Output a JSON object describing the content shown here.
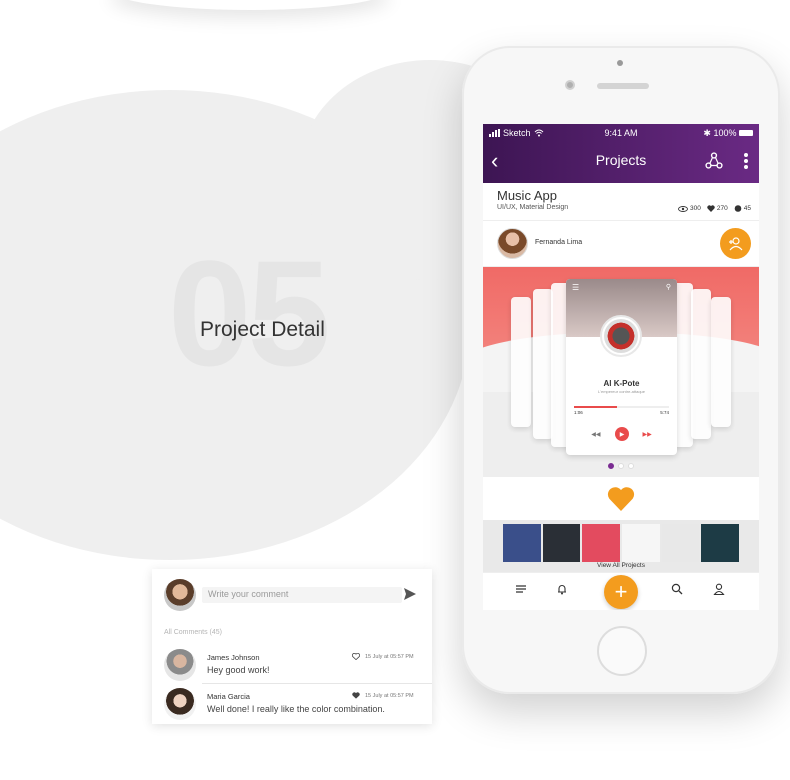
{
  "section": {
    "number": "05",
    "title": "Project Detail"
  },
  "status_bar": {
    "carrier": "Sketch",
    "time": "9:41 AM",
    "battery": "100%"
  },
  "app_bar": {
    "title": "Projects"
  },
  "project": {
    "name": "Music App",
    "tags": "UI/UX, Material Design",
    "views": "300",
    "likes": "270",
    "comments": "45"
  },
  "author": {
    "name": "Fernanda Lima"
  },
  "showcase": {
    "track_title": "Al K-Pote",
    "track_subtitle": "L'empereur contre-attaque",
    "time_elapsed": "1:06",
    "time_total": "5:74",
    "progress": 0.45,
    "active_slide": 0
  },
  "gallery": {
    "view_all_label": "View All Projects",
    "thumbnails": [
      {
        "name": "thumbnail-1",
        "color": "#3a4f8a"
      },
      {
        "name": "thumbnail-2",
        "color": "#2a2f36"
      },
      {
        "name": "thumbnail-3",
        "color": "#e34b5f"
      },
      {
        "name": "thumbnail-4",
        "color": "#f6f6f6"
      },
      {
        "name": "thumbnail-5",
        "color": "#e8e8e8"
      },
      {
        "name": "thumbnail-6",
        "color": "#1d3b45"
      }
    ]
  },
  "comments_panel": {
    "placeholder": "Write your comment",
    "all_comments_label": "All Comments (45)",
    "items": [
      {
        "name": "James Johnson",
        "text": "Hey good work!",
        "date": "15 July at 05:57 PM",
        "liked": false
      },
      {
        "name": "Maria Garcia",
        "text": "Well done! I really like the color combination.",
        "date": "15 July at 05:57 PM",
        "liked": true
      }
    ]
  },
  "colors": {
    "appbar_start": "#3d1553",
    "appbar_end": "#6a2a84",
    "accent_orange": "#f39c1e",
    "accent_red": "#e94b4b"
  }
}
